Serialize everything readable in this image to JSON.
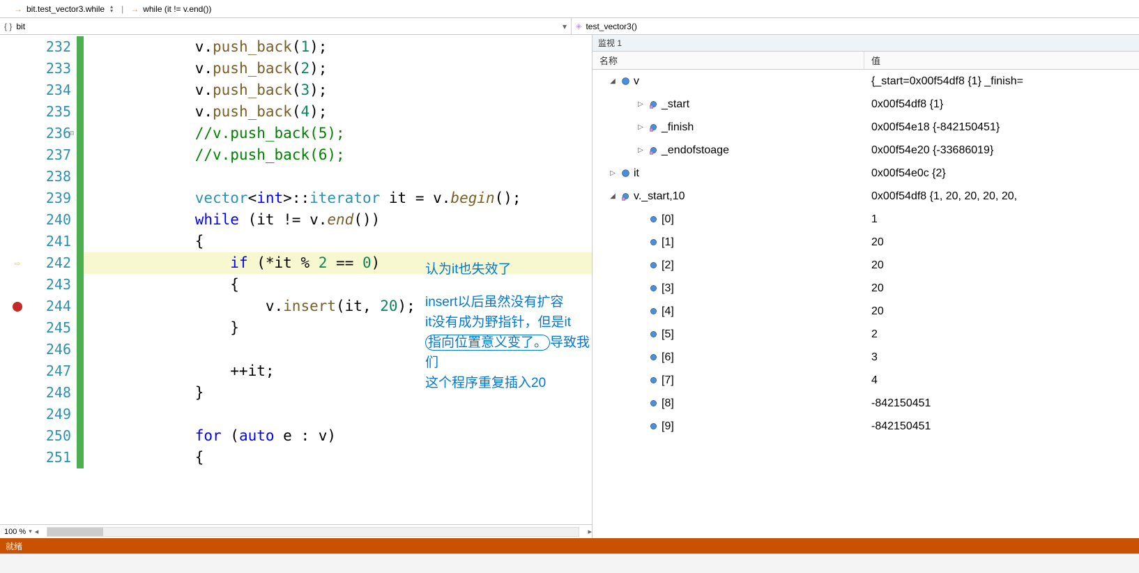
{
  "crumb": {
    "item1": "bit.test_vector3.while",
    "item2": "while (it != v.end())"
  },
  "scope": {
    "left": "bit",
    "right": "test_vector3()"
  },
  "zoom": "100 %",
  "status": "就绪",
  "lines": {
    "232": {
      "n": "232",
      "pre": "            v.",
      "fn": "push_back",
      "arg": "1",
      "tail": ");"
    },
    "233": {
      "n": "233",
      "pre": "            v.",
      "fn": "push_back",
      "arg": "2",
      "tail": ");"
    },
    "234": {
      "n": "234",
      "pre": "            v.",
      "fn": "push_back",
      "arg": "3",
      "tail": ");"
    },
    "235": {
      "n": "235",
      "pre": "            v.",
      "fn": "push_back",
      "arg": "4",
      "tail": ");"
    },
    "236": {
      "n": "236",
      "cm": "            //v.push_back(5);"
    },
    "237": {
      "n": "237",
      "cm": "            //v.push_back(6);"
    },
    "238": {
      "n": "238"
    },
    "239": {
      "n": "239",
      "pre": "            ",
      "cls": "vector",
      "tpl1": "<",
      "kw_int": "int",
      "tpl2": ">::",
      "cls2": "iterator",
      "sp": " it = v.",
      "fn": "begin",
      "tail": "();"
    },
    "240": {
      "n": "240",
      "pre": "            ",
      "kw": "while",
      "mid": " (it != v.",
      "fn": "end",
      "tail": "())"
    },
    "241": {
      "n": "241",
      "txt": "            {"
    },
    "242": {
      "n": "242",
      "pre": "                ",
      "kw": "if",
      "cond_a": " (*it % ",
      "num2": "2",
      "cond_b": " == ",
      "num0": "0",
      "cond_c": ")"
    },
    "243": {
      "n": "243",
      "txt": "                {"
    },
    "244": {
      "n": "244",
      "pre": "                    v.",
      "fn": "insert",
      "mid": "(it, ",
      "num": "20",
      "tail": ");"
    },
    "245": {
      "n": "245",
      "txt": "                }"
    },
    "246": {
      "n": "246"
    },
    "247": {
      "n": "247",
      "txt": "                ++it;"
    },
    "248": {
      "n": "248",
      "txt": "            }"
    },
    "249": {
      "n": "249"
    },
    "250": {
      "n": "250",
      "pre": "            ",
      "kw": "for",
      "mid": " (",
      "kw2": "auto",
      "tail": " e : v)"
    },
    "251": {
      "n": "251",
      "txt": "            {"
    }
  },
  "annot": {
    "l1": "认为it也失效了",
    "l2": "insert以后虽然没有扩容",
    "l3a": "it没有成为野指针，但是it",
    "l4a": "指向位置意义变了。",
    "l4b": "导致我们",
    "l5": "这个程序重复插入20"
  },
  "watch": {
    "title": "监视 1",
    "head_name": "名称",
    "head_val": "值",
    "rows": [
      {
        "depth": 0,
        "exp": "▢",
        "icon": "obj",
        "name": "v",
        "val": "{_start=0x00f54df8 {1} _finish="
      },
      {
        "depth": 1,
        "exp": "▷",
        "icon": "field",
        "name": "_start",
        "val": "0x00f54df8 {1}"
      },
      {
        "depth": 1,
        "exp": "▷",
        "icon": "field",
        "name": "_finish",
        "val": "0x00f54e18 {-842150451}"
      },
      {
        "depth": 1,
        "exp": "▷",
        "icon": "field",
        "name": "_endofstoage",
        "val": "0x00f54e20 {-33686019}"
      },
      {
        "depth": 0,
        "exp": "▷",
        "icon": "obj",
        "name": "it",
        "val": "0x00f54e0c {2}"
      },
      {
        "depth": 0,
        "exp": "▢",
        "icon": "field",
        "name": "v._start,10",
        "val": "0x00f54df8 {1, 20, 20, 20, 20, "
      },
      {
        "depth": 1,
        "exp": "",
        "icon": "elem",
        "name": "[0]",
        "val": "1"
      },
      {
        "depth": 1,
        "exp": "",
        "icon": "elem",
        "name": "[1]",
        "val": "20"
      },
      {
        "depth": 1,
        "exp": "",
        "icon": "elem",
        "name": "[2]",
        "val": "20"
      },
      {
        "depth": 1,
        "exp": "",
        "icon": "elem",
        "name": "[3]",
        "val": "20"
      },
      {
        "depth": 1,
        "exp": "",
        "icon": "elem",
        "name": "[4]",
        "val": "20"
      },
      {
        "depth": 1,
        "exp": "",
        "icon": "elem",
        "name": "[5]",
        "val": "2"
      },
      {
        "depth": 1,
        "exp": "",
        "icon": "elem",
        "name": "[6]",
        "val": "3"
      },
      {
        "depth": 1,
        "exp": "",
        "icon": "elem",
        "name": "[7]",
        "val": "4"
      },
      {
        "depth": 1,
        "exp": "",
        "icon": "elem",
        "name": "[8]",
        "val": "-842150451"
      },
      {
        "depth": 1,
        "exp": "",
        "icon": "elem",
        "name": "[9]",
        "val": "-842150451"
      }
    ]
  }
}
